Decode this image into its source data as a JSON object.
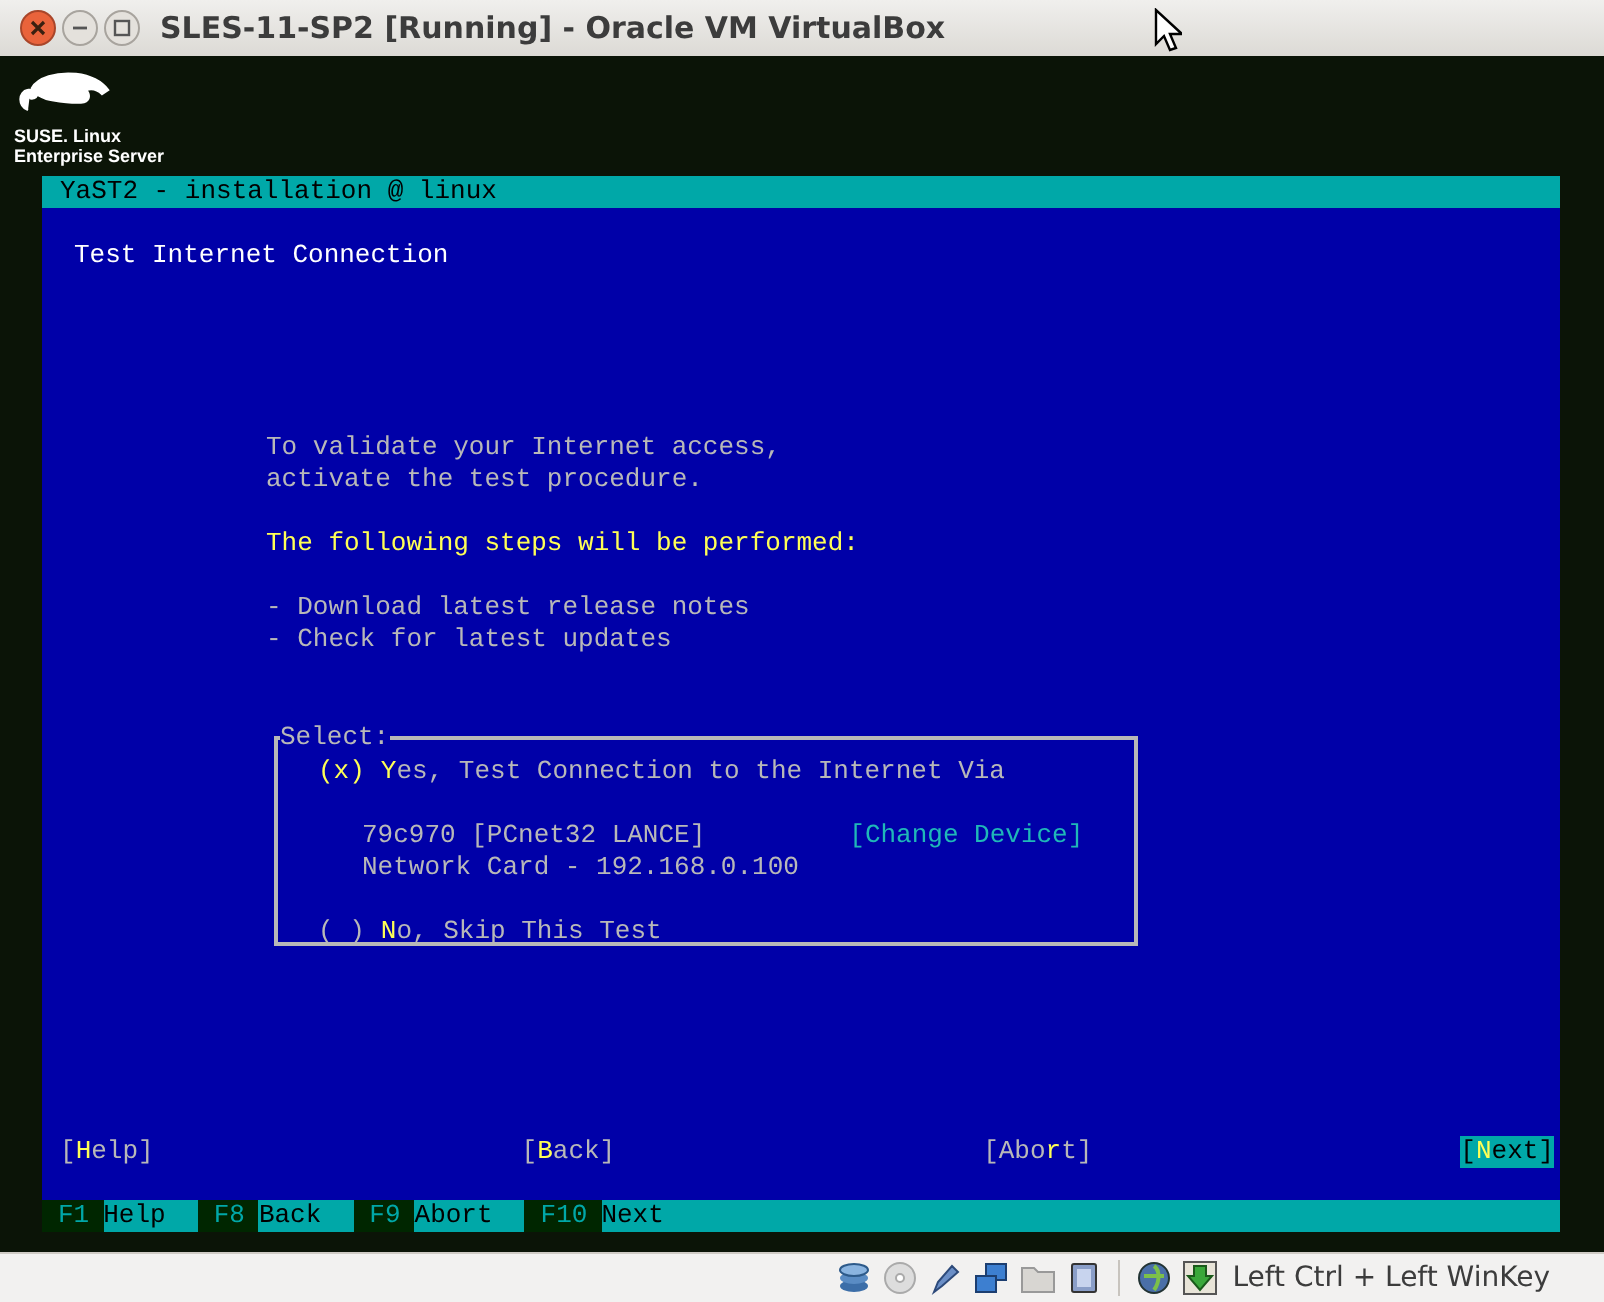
{
  "window": {
    "title": "SLES-11-SP2 [Running] - Oracle VM VirtualBox"
  },
  "brand": {
    "line1": "SUSE. Linux",
    "line2": "Enterprise Server"
  },
  "yast": {
    "header": "YaST2 - installation @ linux",
    "heading": "Test Internet Connection",
    "intro": [
      "To validate your Internet access,",
      "activate the test procedure."
    ],
    "steps_title": "The following steps will be performed:",
    "steps": [
      "- Download latest release notes",
      "- Check for latest updates"
    ],
    "select": {
      "legend": "Select:",
      "options": [
        {
          "indicator": "(x)",
          "label": "**Y**es, Test Connection to the Internet Via",
          "selected": true,
          "device": {
            "name": "79c970 [PCnet32 LANCE]",
            "address": "Network Card - 192.168.0.100",
            "button": "[Change Device]"
          }
        },
        {
          "indicator": "( )",
          "label": "**N**o, Skip This Test",
          "selected": false
        }
      ]
    }
  },
  "buttons": [
    {
      "label": "[**H**elp]",
      "focused": false
    },
    {
      "label": "[**B**ack]",
      "focused": false
    },
    {
      "label": "[Abo**r**t]",
      "focused": false
    },
    {
      "label": "[**N**ext]",
      "focused": true
    }
  ],
  "function_keys": [
    {
      "key": "F1",
      "label": "Help"
    },
    {
      "key": "F8",
      "label": "Back"
    },
    {
      "key": "F9",
      "label": "Abort"
    },
    {
      "key": "F10",
      "label": "Next"
    }
  ],
  "status_bar": {
    "host_key": "Left Ctrl + Left WinKey"
  }
}
